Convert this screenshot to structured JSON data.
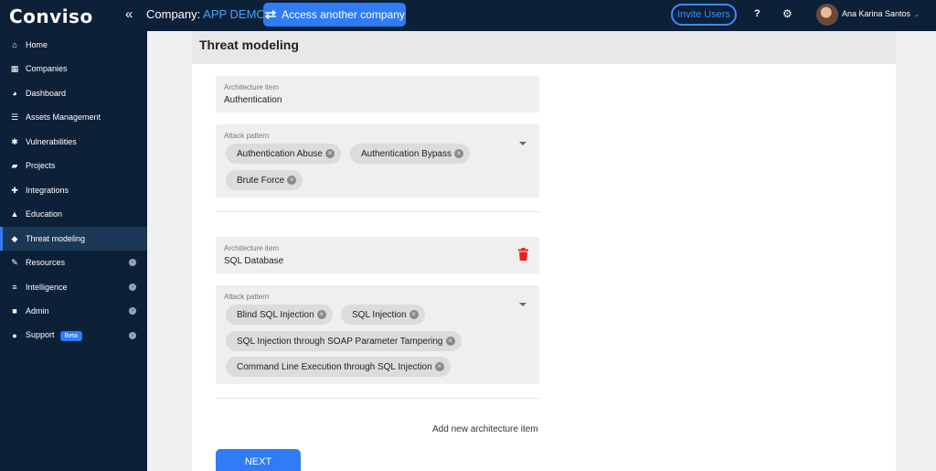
{
  "topbar": {
    "logo": "Conviso",
    "collapse_glyph": "«",
    "company_label": "Company:",
    "company_value": "APP DEMO",
    "access_button": "Access another company",
    "invite_button": "Invite Users",
    "help_glyph": "?",
    "settings_glyph": "⚙",
    "user_name": "Ana Karina Santos",
    "user_caret": "⌄"
  },
  "sidebar": {
    "items": [
      {
        "label": "Home",
        "icon": "home-icon",
        "glyph": "⌂"
      },
      {
        "label": "Companies",
        "icon": "building-icon",
        "glyph": "▦"
      },
      {
        "label": "Dashboard",
        "icon": "dashboard-icon",
        "glyph": "◕"
      },
      {
        "label": "Assets Management",
        "icon": "list-icon",
        "glyph": "☰"
      },
      {
        "label": "Vulnerabilities",
        "icon": "bug-icon",
        "glyph": "✱"
      },
      {
        "label": "Projects",
        "icon": "folder-icon",
        "glyph": "▰"
      },
      {
        "label": "Integrations",
        "icon": "puzzle-icon",
        "glyph": "✚"
      },
      {
        "label": "Education",
        "icon": "graduation-cap-icon",
        "glyph": "▲"
      },
      {
        "label": "Threat modeling",
        "icon": "shield-icon",
        "glyph": "◆",
        "active": true
      },
      {
        "label": "Resources",
        "icon": "wrench-icon",
        "glyph": "✎",
        "chevron": "›"
      },
      {
        "label": "Intelligence",
        "icon": "database-icon",
        "glyph": "≡",
        "chevron": "›"
      },
      {
        "label": "Admin",
        "icon": "briefcase-icon",
        "glyph": "■",
        "chevron": "›"
      },
      {
        "label": "Support",
        "icon": "question-icon",
        "glyph": "●",
        "chevron": "›",
        "badge": "Beta"
      }
    ]
  },
  "main": {
    "title": "Threat modeling",
    "items": [
      {
        "arch_label": "Architecture item",
        "arch_value": "Authentication",
        "attack_label": "Attack pattern",
        "chips": [
          "Authentication Abuse",
          "Authentication Bypass",
          "Brute Force"
        ]
      },
      {
        "arch_label": "Architecture item",
        "arch_value": "SQL Database",
        "attack_label": "Attack pattern",
        "chips": [
          "Blind SQL Injection",
          "SQL Injection",
          "SQL Injection through SOAP Parameter Tampering",
          "Command Line Execution through SQL Injection"
        ]
      }
    ],
    "chip_remove_glyph": "×",
    "add_item": "Add new architecture item",
    "next_button": "NEXT"
  },
  "colors": {
    "nav_bg": "#0c2037",
    "accent": "#2f7cf6",
    "delete": "#e5231b"
  }
}
